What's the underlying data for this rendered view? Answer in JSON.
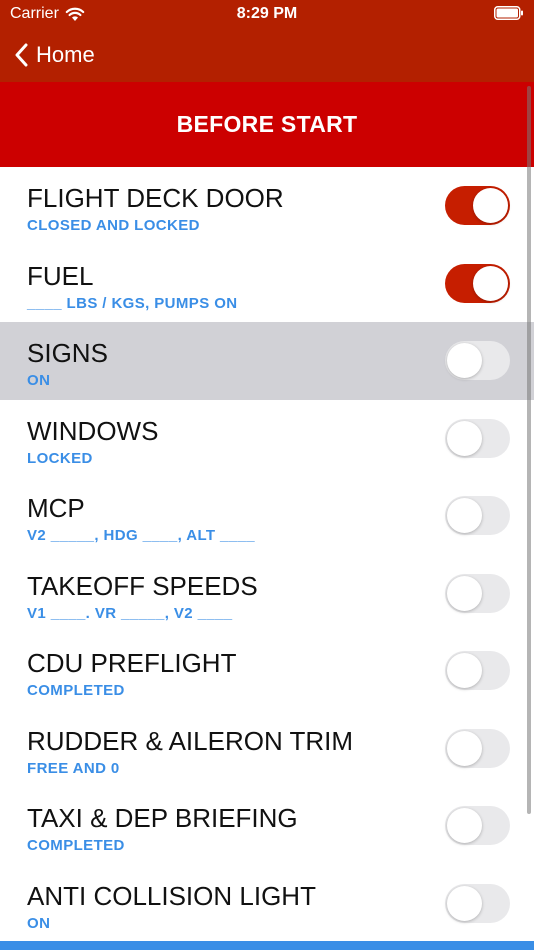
{
  "status_bar": {
    "carrier": "Carrier",
    "time": "8:29 PM",
    "icons": [
      "wifi-icon",
      "battery-icon"
    ]
  },
  "nav": {
    "back_label": "Home",
    "back_icon": "chevron-left-icon"
  },
  "section": {
    "title": "BEFORE START"
  },
  "colors": {
    "nav_bar": "#b32000",
    "section_header": "#cc0000",
    "toggle_on": "#c61e00",
    "subtitle": "#3a8ee6",
    "highlight_row": "#d1d1d6"
  },
  "items": [
    {
      "title": "FLIGHT DECK DOOR",
      "subtitle": "CLOSED AND LOCKED",
      "checked": true
    },
    {
      "title": "FUEL",
      "subtitle": "____ LBS / KGS, PUMPS ON",
      "checked": true
    },
    {
      "title": "SIGNS",
      "subtitle": "ON",
      "checked": false,
      "highlighted": true
    },
    {
      "title": "WINDOWS",
      "subtitle": "LOCKED",
      "checked": false
    },
    {
      "title": "MCP",
      "subtitle": "V2 _____, HDG ____, ALT ____",
      "checked": false
    },
    {
      "title": "TAKEOFF SPEEDS",
      "subtitle": "V1 ____. VR _____, V2 ____",
      "checked": false
    },
    {
      "title": "CDU PREFLIGHT",
      "subtitle": "COMPLETED",
      "checked": false
    },
    {
      "title": "RUDDER & AILERON TRIM",
      "subtitle": "FREE AND 0",
      "checked": false
    },
    {
      "title": "TAXI & DEP BRIEFING",
      "subtitle": "COMPLETED",
      "checked": false
    },
    {
      "title": "ANTI COLLISION LIGHT",
      "subtitle": "ON",
      "checked": false
    }
  ]
}
